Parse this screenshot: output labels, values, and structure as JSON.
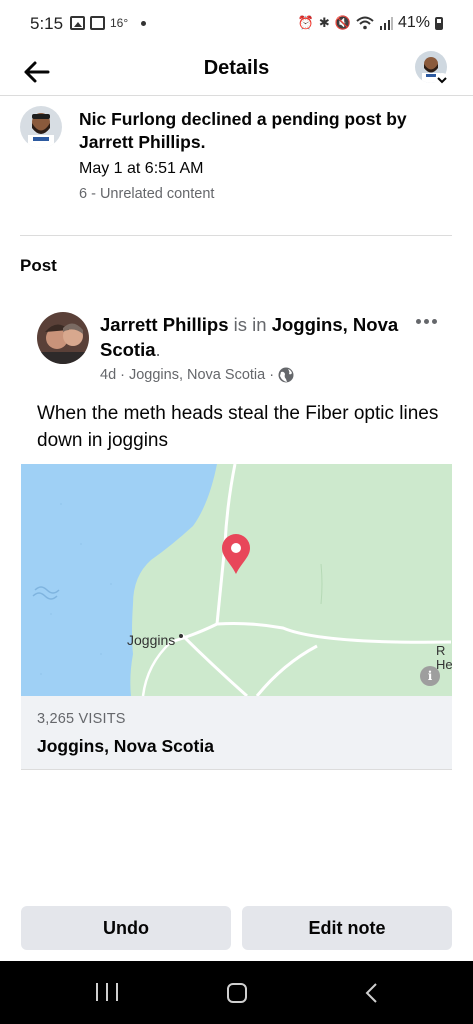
{
  "status_bar": {
    "time": "5:15",
    "temperature": "16°",
    "battery": "41%"
  },
  "header": {
    "title": "Details"
  },
  "activity": {
    "text": "Nic Furlong declined a pending post by Jarrett Phillips.",
    "time": "May 1 at 6:51 AM",
    "reason": "6 - Unrelated content"
  },
  "post_section": {
    "heading": "Post"
  },
  "post": {
    "author": "Jarrett Phillips",
    "connector": "is in",
    "location": "Joggins, Nova Scotia",
    "period": ".",
    "age": "4d",
    "meta_location": "Joggins, Nova Scotia",
    "separator": "·",
    "body": "When the meth heads steal the Fiber optic lines down in joggins"
  },
  "map": {
    "place_label": "Joggins",
    "edge_label_1": "R",
    "edge_label_2": "He",
    "info_glyph": "i",
    "visits": "3,265 VISITS",
    "title": "Joggins, Nova Scotia",
    "colors": {
      "water": "#9fd0f5",
      "land": "#cde9cd",
      "road": "#ffffff",
      "pin": "#e8475a"
    }
  },
  "actions": {
    "undo": "Undo",
    "edit_note": "Edit note"
  }
}
